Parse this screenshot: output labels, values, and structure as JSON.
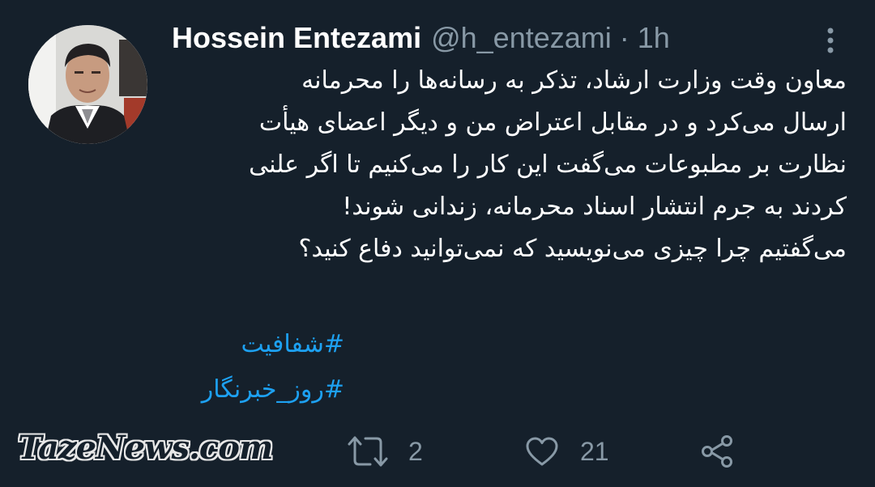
{
  "tweet": {
    "author_name": "Hossein Entezami",
    "handle": "@h_entezami",
    "separator": "·",
    "time": "1h",
    "lines": [
      "معاون وقت وزارت ارشاد، تذکر به رسانه‌ها را محرمانه",
      "ارسال می‌کرد و در مقابل اعتراض من و دیگر اعضای هیأت",
      "نظارت بر مطبوعات می‌گفت این کار را می‌کنیم تا اگر علنی",
      "کردند به جرم انتشار اسناد محرمانه، زندانی شوند!",
      "می‌گفتیم چرا چیزی می‌نویسید که نمی‌توانید دفاع کنید؟"
    ],
    "hashtags": [
      "#شفافیت",
      "#روز_خبرنگار"
    ],
    "actions": {
      "retweet_count": "2",
      "like_count": "21"
    }
  },
  "watermark": "TazeNews.com",
  "icons": {
    "more": "more-vertical-icon",
    "retweet": "retweet-icon",
    "like": "heart-icon",
    "share": "share-icon"
  },
  "colors": {
    "background": "#15202b",
    "text": "#ffffff",
    "secondary": "#8899a6",
    "link": "#1da1f2"
  }
}
